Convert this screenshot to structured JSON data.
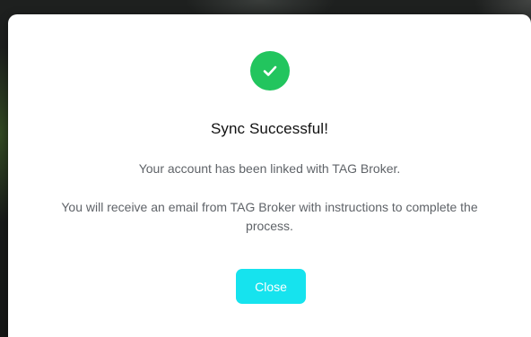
{
  "modal": {
    "icon": "check-circle-icon",
    "title": "Sync Successful!",
    "message_1": "Your account has been linked with TAG Broker.",
    "message_2": "You will receive an email from TAG Broker with instructions to complete the process.",
    "close_label": "Close"
  },
  "colors": {
    "success": "#22c55e",
    "accent": "#16e3ee",
    "title_text": "#111111",
    "body_text": "#5f6368"
  }
}
